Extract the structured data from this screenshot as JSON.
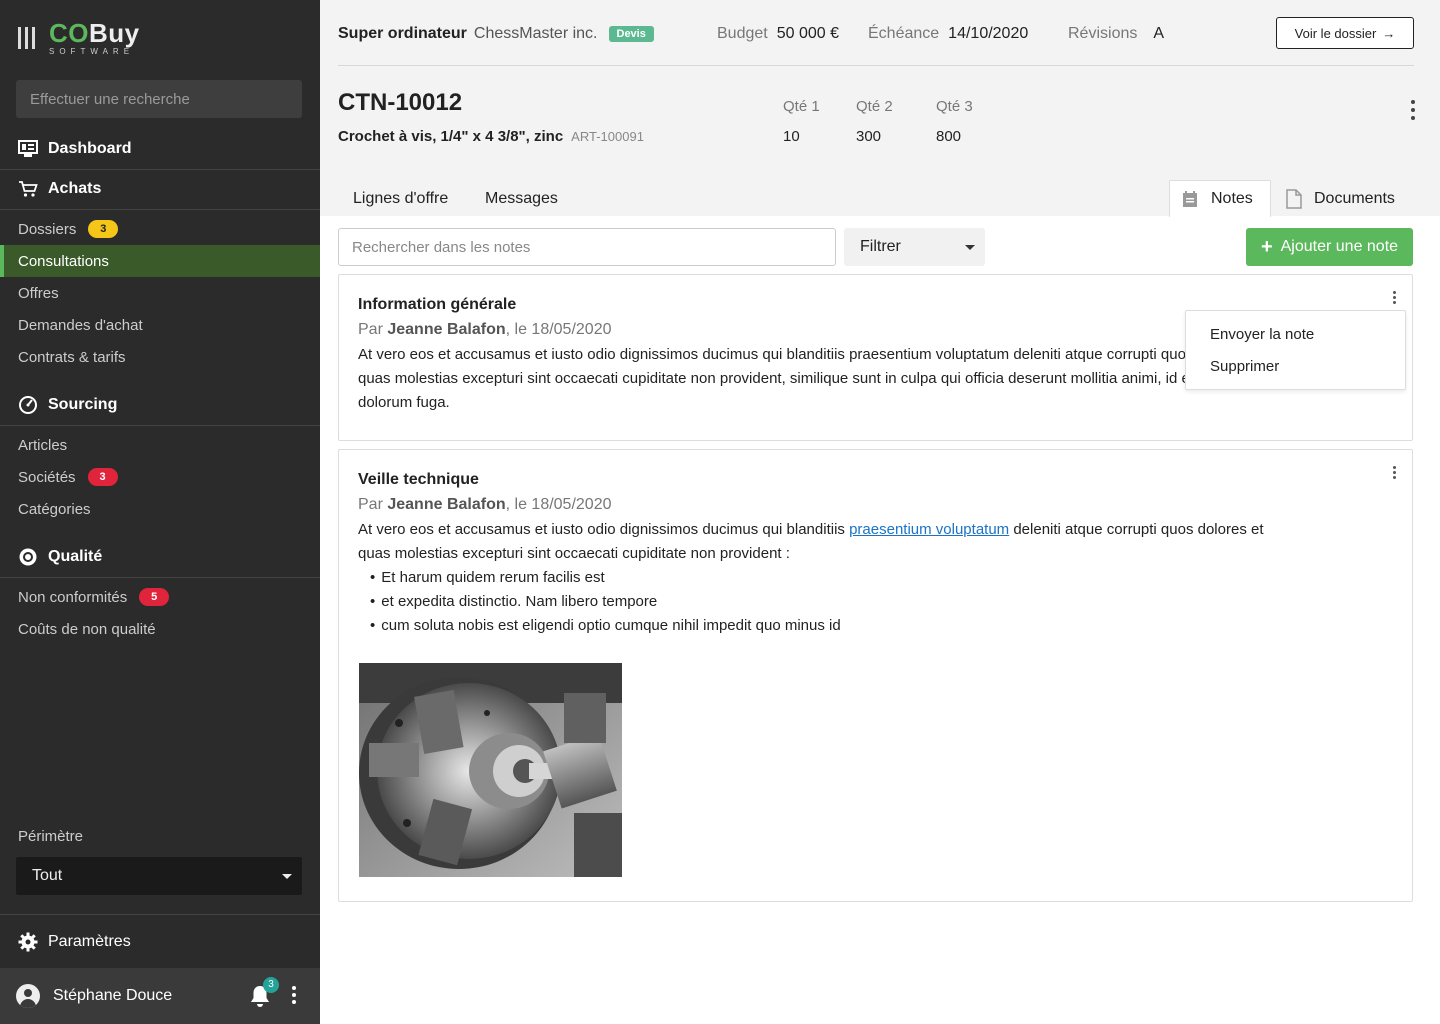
{
  "brand": {
    "co": "CO",
    "buy": "Buy",
    "sub": "SOFTWARE"
  },
  "sidebar": {
    "search_placeholder": "Effectuer une recherche",
    "dashboard": "Dashboard",
    "achats": {
      "title": "Achats",
      "items": [
        {
          "label": "Dossiers",
          "badge": "3"
        },
        {
          "label": "Consultations"
        },
        {
          "label": "Offres"
        },
        {
          "label": "Demandes d'achat"
        },
        {
          "label": "Contrats & tarifs"
        }
      ]
    },
    "sourcing": {
      "title": "Sourcing",
      "items": [
        {
          "label": "Articles"
        },
        {
          "label": "Sociétés",
          "badge": "3"
        },
        {
          "label": "Catégories"
        }
      ]
    },
    "qualite": {
      "title": "Qualité",
      "items": [
        {
          "label": "Non conformités",
          "badge": "5"
        },
        {
          "label": "Coûts de non qualité"
        }
      ]
    },
    "perimetre_label": "Périmètre",
    "perimetre_value": "Tout",
    "parametres": "Paramètres",
    "user_name": "Stéphane Douce",
    "notif_count": "3"
  },
  "header": {
    "title": "Super ordinateur",
    "company": "ChessMaster inc.",
    "tag": "Devis",
    "budget_label": "Budget",
    "budget_value": "50 000 €",
    "echeance_label": "Échéance",
    "echeance_value": "14/10/2020",
    "revisions_label": "Révisions",
    "revisions_value": "A",
    "dossier_button": "Voir le dossier"
  },
  "item": {
    "code": "CTN-10012",
    "name": "Crochet à vis, 1/4\" x 4 3/8\", zinc",
    "ref": "ART-100091",
    "quantities": [
      {
        "label": "Qté 1",
        "value": "10"
      },
      {
        "label": "Qté 2",
        "value": "300"
      },
      {
        "label": "Qté 3",
        "value": "800"
      }
    ]
  },
  "tabs": {
    "lignes": "Lignes d'offre",
    "messages": "Messages",
    "notes": "Notes",
    "documents": "Documents"
  },
  "notes_toolbar": {
    "search_placeholder": "Rechercher dans les notes",
    "filter": "Filtrer",
    "add_button": "Ajouter une note"
  },
  "notes": [
    {
      "title": "Information générale",
      "by_prefix": "Par",
      "author": "Jeanne Balafon",
      "date_suffix": ", le 18/05/2020",
      "line1": "At vero eos et accusamus et iusto odio dignissimos ducimus qui blanditiis praesentium voluptatum deleniti atque corrupti quos dolores et",
      "line2": "quas molestias excepturi sint occaecati cupiditate non provident, similique sunt in culpa qui officia deserunt mollitia animi, id est laborum et",
      "line3": "dolorum fuga."
    },
    {
      "title": "Veille technique",
      "by_prefix": "Par",
      "author": "Jeanne Balafon",
      "date_suffix": ", le 18/05/2020",
      "line1_pre": "At vero eos et accusamus et iusto odio dignissimos ducimus qui blanditiis ",
      "line1_link": "praesentium voluptatum",
      "line1_post": " deleniti atque corrupti quos dolores et",
      "line2": "quas molestias excepturi sint occaecati cupiditate non provident :",
      "bullets": [
        "Et harum quidem rerum facilis est",
        "et expedita distinctio. Nam libero tempore",
        "cum soluta nobis est eligendi optio cumque nihil impedit quo minus id"
      ]
    }
  ],
  "note_menu": {
    "send": "Envoyer la note",
    "delete": "Supprimer"
  },
  "colors": {
    "accent": "#5cb85c",
    "sidebar_bg": "#2b2b2b",
    "active_item_bg": "#3a5a2a",
    "badge_yellow": "#f5c518",
    "badge_red": "#e0243c",
    "tag_green": "#5cb890",
    "link": "#1a73c8"
  }
}
